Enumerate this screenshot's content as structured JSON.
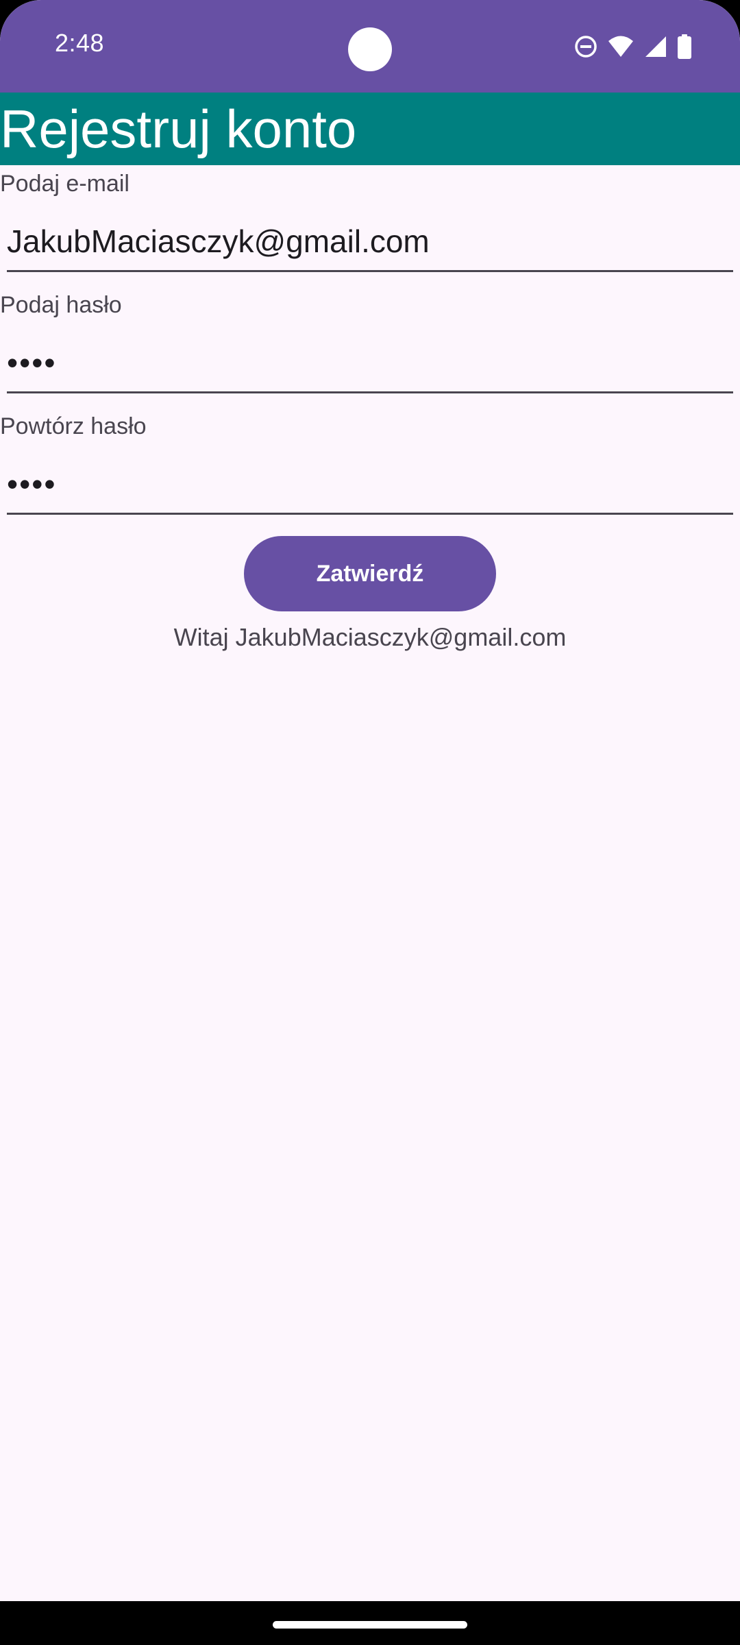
{
  "status_bar": {
    "time": "2:48",
    "icons": [
      "do-not-disturb-icon",
      "wifi-icon",
      "cellular-signal-icon",
      "battery-icon"
    ],
    "background_color": "#6750A4"
  },
  "app_bar": {
    "title": "Rejestruj konto",
    "background_color": "#008080"
  },
  "form": {
    "email": {
      "label": "Podaj e-mail",
      "value": "JakubMaciasczyk@gmail.com"
    },
    "password": {
      "label": "Podaj hasło",
      "value": "••••"
    },
    "repeat_password": {
      "label": "Powtórz hasło",
      "value": "••••"
    },
    "submit_label": "Zatwierdź",
    "welcome_message": "Witaj JakubMaciasczyk@gmail.com"
  },
  "colors": {
    "accent": "#6750A4",
    "app_bar": "#008080",
    "background": "#FDF6FD"
  }
}
